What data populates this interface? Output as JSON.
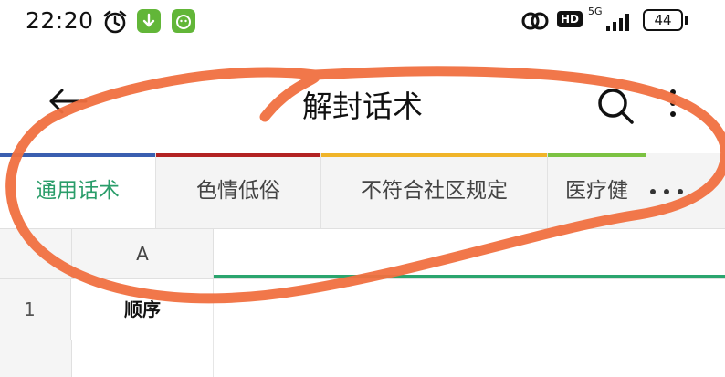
{
  "status_bar": {
    "time": "22:20",
    "hd_label": "HD",
    "network_label": "5G",
    "battery_level": "44",
    "icons": [
      "alarm-icon",
      "download-notification-icon",
      "app-notification-icon",
      "link-icon",
      "signal-icon",
      "battery-icon"
    ]
  },
  "app_bar": {
    "title": "解封话术",
    "icons": [
      "back-arrow-icon",
      "search-icon",
      "more-vert-icon"
    ]
  },
  "tabs": [
    {
      "label": "通用话术",
      "color": "#3a5fb0",
      "active": true
    },
    {
      "label": "色情低俗",
      "color": "#b22222",
      "active": false
    },
    {
      "label": "不符合社区规定",
      "color": "#f0b429",
      "active": false
    },
    {
      "label": "医疗健",
      "color": "#7cc242",
      "active": false
    }
  ],
  "grid": {
    "column_headers": [
      "A"
    ],
    "rows": [
      {
        "number": "1",
        "cells": [
          "顺序"
        ]
      }
    ],
    "selection_color": "#2aa56e"
  },
  "colors": {
    "accent_green": "#2a9d6a",
    "annotation": "#f07040"
  }
}
